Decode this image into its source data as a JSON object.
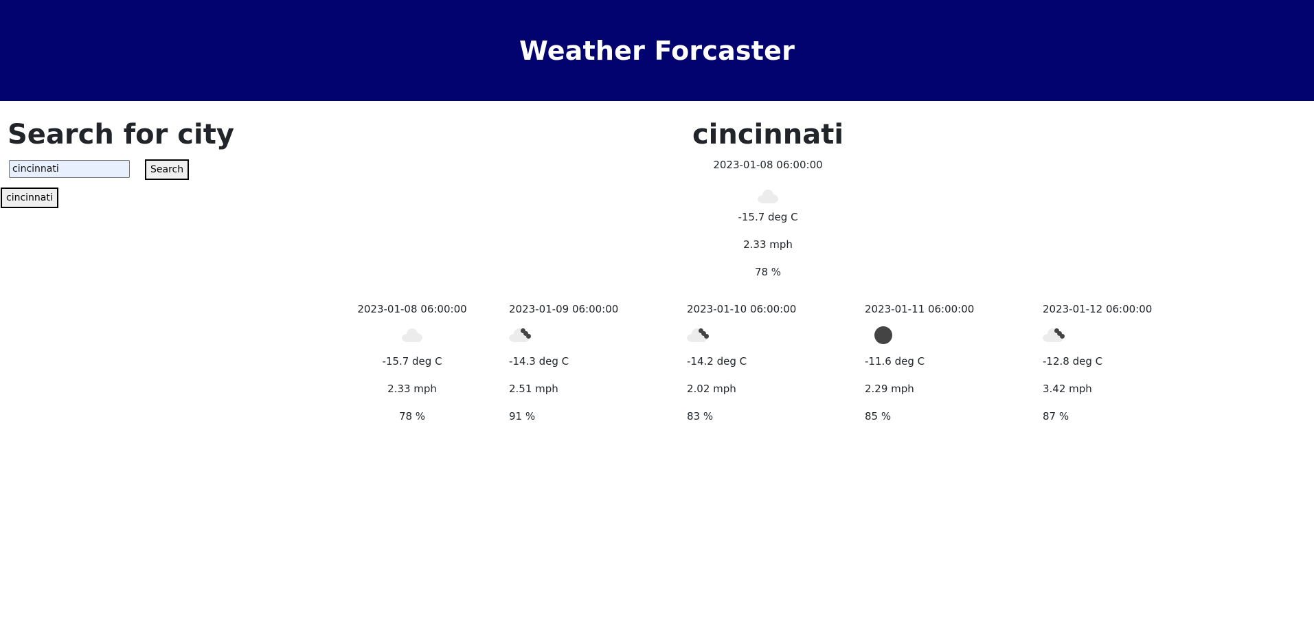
{
  "header": {
    "title": "Weather Forcaster"
  },
  "search": {
    "title": "Search for city",
    "input_value": "cincinnati",
    "button_label": "Search",
    "history": [
      "cincinnati"
    ]
  },
  "current": {
    "city": "cincinnati",
    "date": "2023-01-08 06:00:00",
    "icon": "cloud-icon",
    "temp": "-15.7 deg C",
    "wind": "2.33 mph",
    "humidity": "78 %"
  },
  "forecast": [
    {
      "date": "2023-01-08 06:00:00",
      "icon": "cloud-icon",
      "temp": "-15.7 deg C",
      "wind": "2.33 mph",
      "humidity": "78 %"
    },
    {
      "date": "2023-01-09 06:00:00",
      "icon": "snow-cloud-icon",
      "temp": "-14.3 deg C",
      "wind": "2.51 mph",
      "humidity": "91 %"
    },
    {
      "date": "2023-01-10 06:00:00",
      "icon": "snow-cloud-icon",
      "temp": "-14.2 deg C",
      "wind": "2.02 mph",
      "humidity": "83 %"
    },
    {
      "date": "2023-01-11 06:00:00",
      "icon": "dark-circle-icon",
      "temp": "-11.6 deg C",
      "wind": "2.29 mph",
      "humidity": "85 %"
    },
    {
      "date": "2023-01-12 06:00:00",
      "icon": "snow-cloud-icon",
      "temp": "-12.8 deg C",
      "wind": "3.42 mph",
      "humidity": "87 %"
    }
  ],
  "colors": {
    "header_bg": "#03036f",
    "header_text": "#ffffff",
    "input_bg": "#e8f0fe"
  }
}
